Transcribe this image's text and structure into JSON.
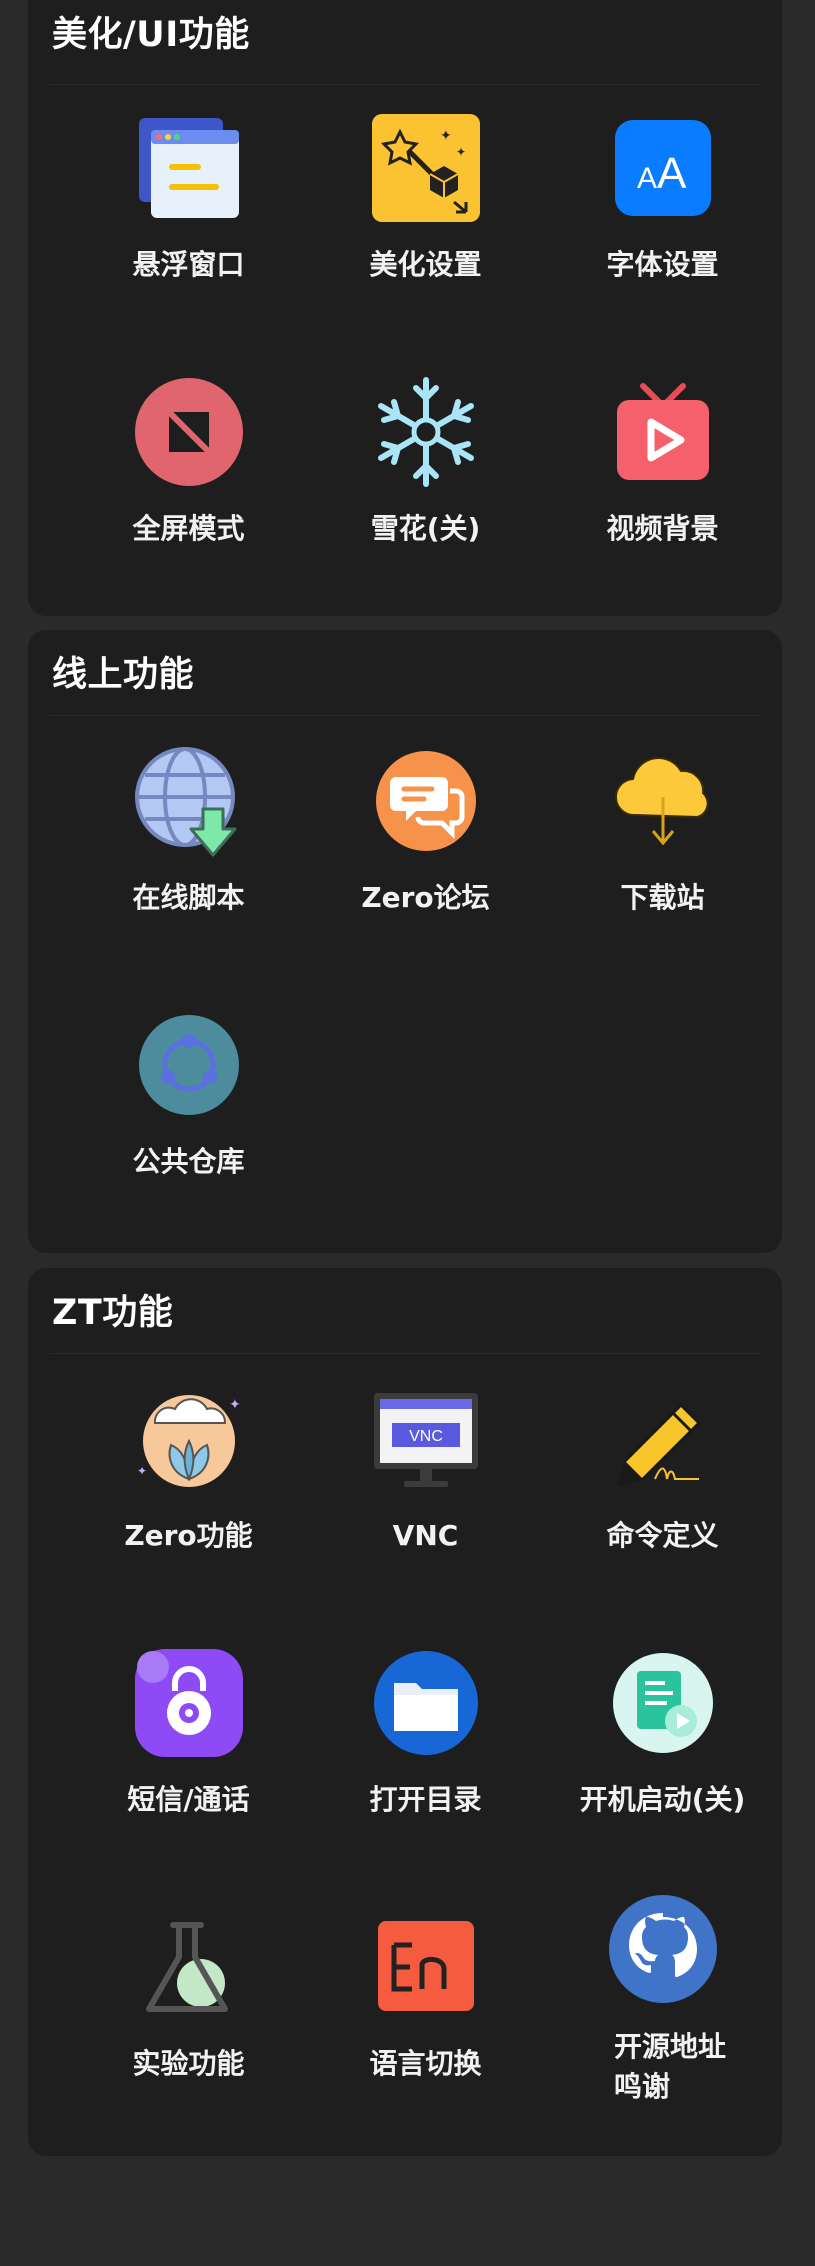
{
  "sections": [
    {
      "title": "美化/UI功能",
      "items": [
        {
          "label": "悬浮窗口",
          "icon": "floating-window-icon"
        },
        {
          "label": "美化设置",
          "icon": "magic-wand-icon"
        },
        {
          "label": "字体设置",
          "icon": "font-icon"
        },
        {
          "label": "全屏模式",
          "icon": "fullscreen-icon"
        },
        {
          "label": "雪花(关)",
          "icon": "snowflake-icon"
        },
        {
          "label": "视频背景",
          "icon": "video-tv-icon"
        }
      ]
    },
    {
      "title": "线上功能",
      "items": [
        {
          "label": "在线脚本",
          "icon": "globe-download-icon"
        },
        {
          "label": "Zero论坛",
          "icon": "chat-bubble-icon"
        },
        {
          "label": "下载站",
          "icon": "cloud-download-icon"
        },
        {
          "label": "公共仓库",
          "icon": "share-circle-icon"
        }
      ]
    },
    {
      "title": "ZT功能",
      "items": [
        {
          "label": "Zero功能",
          "icon": "cloud-plant-icon"
        },
        {
          "label": "VNC",
          "icon": "vnc-monitor-icon"
        },
        {
          "label": "命令定义",
          "icon": "pencil-icon"
        },
        {
          "label": "短信/通话",
          "icon": "lock-app-icon"
        },
        {
          "label": "打开目录",
          "icon": "folder-icon"
        },
        {
          "label": "开机启动(关)",
          "icon": "boot-doc-icon"
        },
        {
          "label": "实验功能",
          "icon": "flask-icon"
        },
        {
          "label": "语言切换",
          "icon": "language-en-icon"
        },
        {
          "label": "开源地址\n鸣谢",
          "icon": "github-icon"
        }
      ]
    }
  ]
}
